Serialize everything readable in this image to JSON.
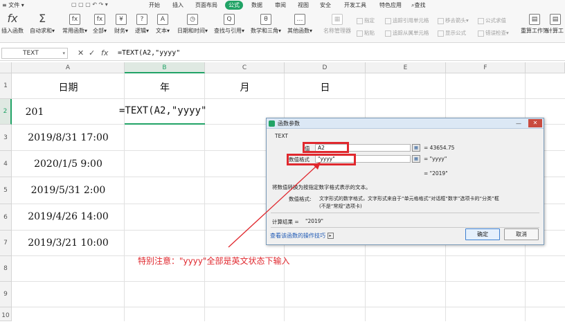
{
  "menubar": {
    "items": [
      {
        "label": "文件"
      },
      {
        "label": "开始"
      },
      {
        "label": "插入"
      },
      {
        "label": "页面布局"
      },
      {
        "label": "公式"
      },
      {
        "label": "数据"
      },
      {
        "label": "审阅"
      },
      {
        "label": "视图"
      },
      {
        "label": "安全"
      },
      {
        "label": "开发工具"
      },
      {
        "label": "特色应用"
      },
      {
        "label": "查找"
      }
    ]
  },
  "ribbon": {
    "buttons": [
      {
        "label": "插入函数",
        "glyph": "fx"
      },
      {
        "label": "自动求和",
        "glyph": "Σ"
      },
      {
        "label": "常用函数",
        "glyph": "fx"
      },
      {
        "label": "全部",
        "glyph": "fx"
      },
      {
        "label": "财务",
        "glyph": "¥"
      },
      {
        "label": "逻辑",
        "glyph": "?"
      },
      {
        "label": "文本",
        "glyph": "A"
      },
      {
        "label": "日期和时间",
        "glyph": "◷"
      },
      {
        "label": "查找与引用",
        "glyph": "Q"
      },
      {
        "label": "数学和三角",
        "glyph": "θ"
      },
      {
        "label": "其他函数",
        "glyph": "…"
      },
      {
        "label": "名称管理器",
        "glyph": "▦"
      },
      {
        "label": "重算工作簿",
        "glyph": "▤"
      },
      {
        "label": "计算工",
        "glyph": "▤"
      }
    ],
    "small": [
      {
        "label": "指定"
      },
      {
        "label": "粘贴"
      },
      {
        "label": "追踪引用单元格"
      },
      {
        "label": "追踪从属单元格"
      },
      {
        "label": "移去箭头"
      },
      {
        "label": "显示公式"
      },
      {
        "label": "公式求值"
      },
      {
        "label": "错误检查"
      }
    ]
  },
  "formula_bar": {
    "name_box": "TEXT",
    "cancel_glyph": "✕",
    "confirm_glyph": "✓",
    "fx_glyph": "fx",
    "formula": "=TEXT(A2,\"yyyy\""
  },
  "sheet": {
    "columns": [
      "A",
      "B",
      "C",
      "D",
      "E",
      "F"
    ],
    "rows": [
      "1",
      "2",
      "3",
      "4",
      "5",
      "6",
      "7",
      "8",
      "9",
      "10"
    ],
    "header_row": [
      "日期",
      "年",
      "月",
      "日"
    ],
    "a_values": [
      "201",
      "2019/8/31 17:00",
      "2020/1/5 9:00",
      "2019/5/31 2:00",
      "2019/4/26 14:00",
      "2019/3/21 10:00"
    ],
    "edit_text": "=TEXT(A2,\"yyyy\""
  },
  "dialog": {
    "title": "函数参数",
    "function_name": "TEXT",
    "arg1_label": "值",
    "arg1_value": "A2",
    "arg1_result": "= 43654.75",
    "arg2_label": "数值格式",
    "arg2_value": "\"yyyy\"",
    "arg2_result": "= \"yyyy\"",
    "total_result": "= \"2019\"",
    "description": "将数值转换为按指定数字格式表示的文本。",
    "param_desc_label": "数值格式:",
    "param_desc": "文字形式的数字格式，文字形式来自于“单元格格式”对话框“数字”选项卡的“分类”框",
    "param_desc2": "(不是“常规”选项卡)",
    "calc_label": "计算结果 =",
    "calc_value": "\"2019\"",
    "help_link": "查看该函数的操作技巧",
    "ok_label": "确定",
    "cancel_label": "取消"
  },
  "annotation": {
    "note": "特别注意：\"yyyy\"全部是英文状态下输入",
    "color": "#e0282e"
  }
}
